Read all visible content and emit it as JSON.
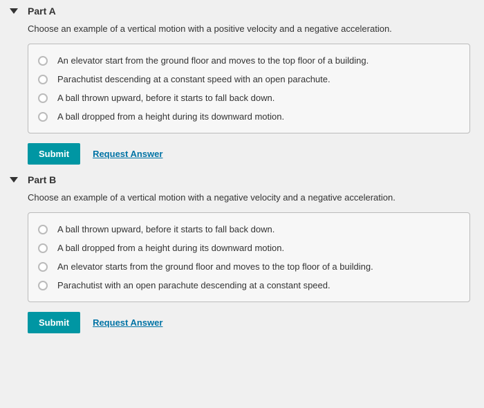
{
  "parts": [
    {
      "title": "Part A",
      "prompt": "Choose an example of a vertical motion with a positive velocity and a negative acceleration.",
      "options": [
        "An elevator start from the ground floor and moves to the top floor of a building.",
        "Parachutist descending at a constant speed with an open parachute.",
        "A ball thrown upward, before it starts to fall back down.",
        "A ball dropped from a height during its downward motion."
      ],
      "submit": "Submit",
      "request": "Request Answer"
    },
    {
      "title": "Part B",
      "prompt": "Choose an example of a vertical motion with a negative velocity and a negative acceleration.",
      "options": [
        "A ball thrown upward, before it starts to fall back down.",
        "A ball dropped from a height during its downward motion.",
        "An elevator starts from the ground floor and moves to the top floor of a building.",
        "Parachutist with an open parachute descending at a constant speed."
      ],
      "submit": "Submit",
      "request": "Request Answer"
    }
  ]
}
